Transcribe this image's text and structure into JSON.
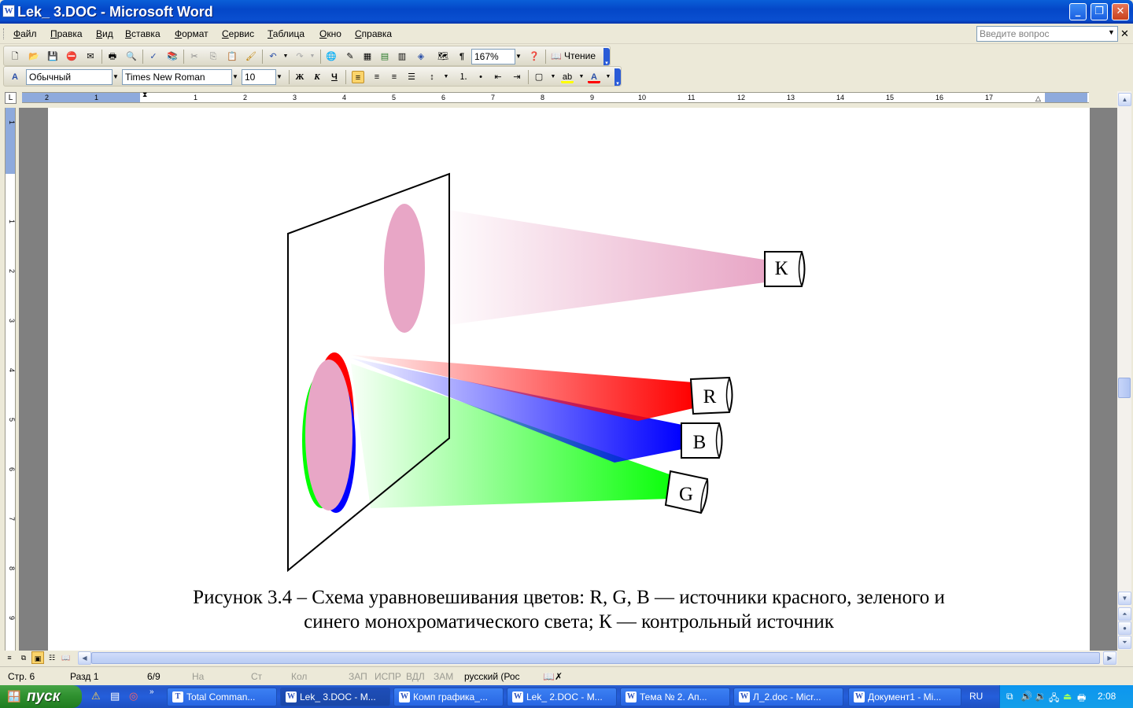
{
  "window": {
    "title": "Lek_ 3.DOC - Microsoft Word",
    "icon": "word-doc-icon"
  },
  "menu": [
    "Файл",
    "Правка",
    "Вид",
    "Вставка",
    "Формат",
    "Сервис",
    "Таблица",
    "Окно",
    "Справка"
  ],
  "help": {
    "placeholder": "Введите вопрос"
  },
  "standard_toolbar": {
    "zoom": "167%",
    "reading_label": "Чтение"
  },
  "format_toolbar": {
    "style": "Обычный",
    "font": "Times New Roman",
    "size": "10",
    "bold": "Ж",
    "italic": "К",
    "underline": "Ч"
  },
  "ruler": {
    "h_labels": [
      "2",
      "1",
      "1",
      "2",
      "3",
      "4",
      "5",
      "6",
      "7",
      "8",
      "9",
      "10",
      "11",
      "12",
      "13",
      "14",
      "15",
      "16",
      "17"
    ],
    "v_labels": [
      "1",
      "1",
      "2",
      "3",
      "4",
      "5",
      "6",
      "7",
      "8",
      "9"
    ]
  },
  "figure": {
    "sources": [
      "К",
      "R",
      "B",
      "G"
    ],
    "colors": {
      "pink": "#e8a6c6",
      "red": "#ff0000",
      "blue": "#0000ff",
      "green": "#00ff00"
    },
    "caption_line1": "Рисунок 3.4 – Схема уравновешивания цветов: R, G, B — источники красного, зеленого и",
    "caption_line2": "синего монохроматического света; К — контрольный источник"
  },
  "status": {
    "page": "Стр. 6",
    "section": "Разд 1",
    "pages": "6/9",
    "at": "На",
    "line": "Ст",
    "col": "Кол",
    "rec": "ЗАП",
    "trk": "ИСПР",
    "ext": "ВДЛ",
    "ovr": "ЗАМ",
    "language": "русский (Рос"
  },
  "taskbar": {
    "start": "пуск",
    "tasks": [
      "Total Comman...",
      "Lek_ 3.DOC - M...",
      "Комп графика_...",
      "Lek_ 2.DOC - M...",
      "Тема № 2. Ап...",
      "Л_2.doc - Micr...",
      "Документ1 - Mi..."
    ],
    "lang": "RU",
    "clock": "2:08"
  }
}
